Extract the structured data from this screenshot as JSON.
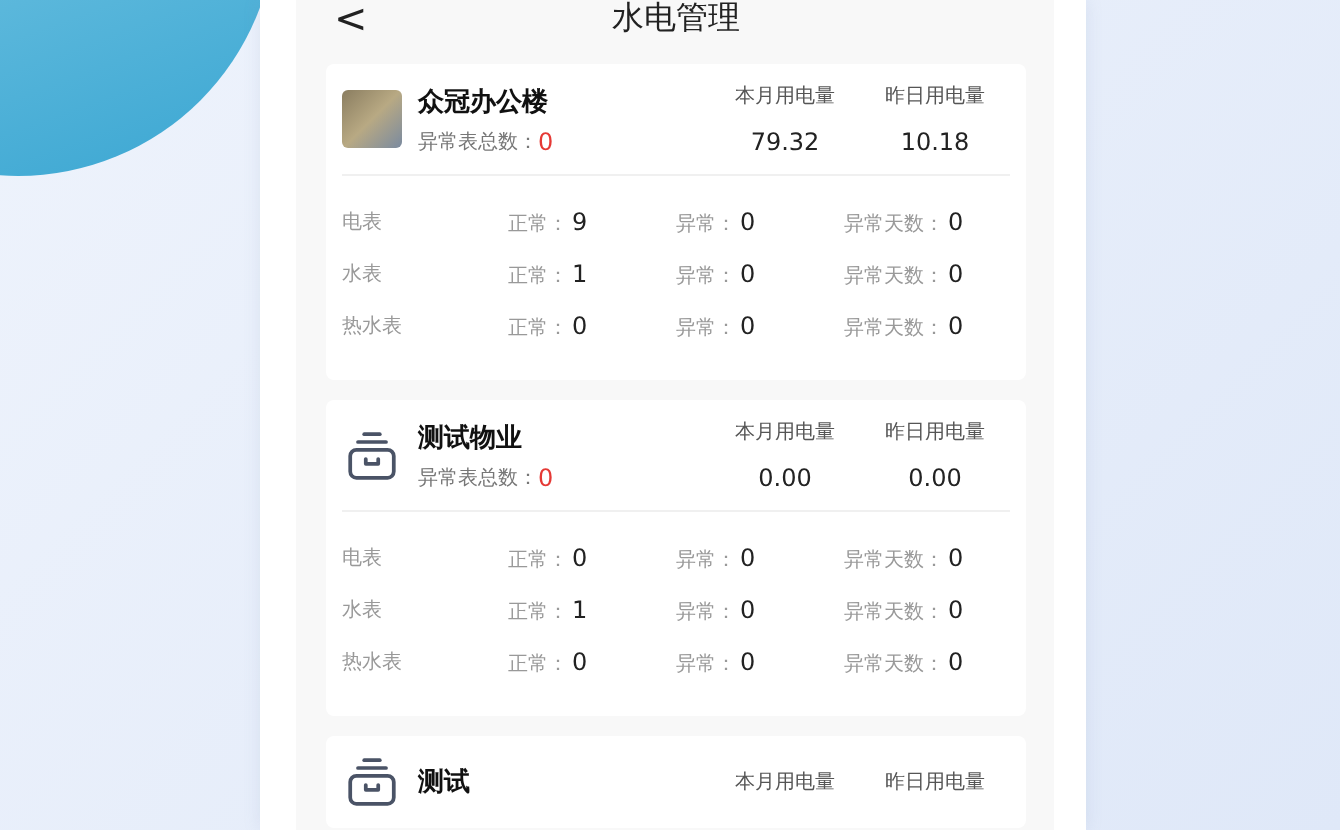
{
  "header": {
    "back": "<",
    "title": "水电管理"
  },
  "cards": [
    {
      "kind": "photo",
      "name": "众冠办公楼",
      "abnormal_label": "异常表总数：",
      "abnormal_total": "0",
      "metrics": [
        {
          "label": "本月用电量",
          "value": "79.32"
        },
        {
          "label": "昨日用电量",
          "value": "10.18"
        }
      ],
      "rows": [
        {
          "name": "电表",
          "stats": [
            {
              "label": "正常：",
              "value": "9"
            },
            {
              "label": "异常：",
              "value": "0"
            },
            {
              "label": "异常天数：",
              "value": "0"
            }
          ]
        },
        {
          "name": "水表",
          "stats": [
            {
              "label": "正常：",
              "value": "1"
            },
            {
              "label": "异常：",
              "value": "0"
            },
            {
              "label": "异常天数：",
              "value": "0"
            }
          ]
        },
        {
          "name": "热水表",
          "stats": [
            {
              "label": "正常：",
              "value": "0"
            },
            {
              "label": "异常：",
              "value": "0"
            },
            {
              "label": "异常天数：",
              "value": "0"
            }
          ]
        }
      ]
    },
    {
      "kind": "icon",
      "name": "测试物业",
      "abnormal_label": "异常表总数：",
      "abnormal_total": "0",
      "metrics": [
        {
          "label": "本月用电量",
          "value": "0.00"
        },
        {
          "label": "昨日用电量",
          "value": "0.00"
        }
      ],
      "rows": [
        {
          "name": "电表",
          "stats": [
            {
              "label": "正常：",
              "value": "0"
            },
            {
              "label": "异常：",
              "value": "0"
            },
            {
              "label": "异常天数：",
              "value": "0"
            }
          ]
        },
        {
          "name": "水表",
          "stats": [
            {
              "label": "正常：",
              "value": "1"
            },
            {
              "label": "异常：",
              "value": "0"
            },
            {
              "label": "异常天数：",
              "value": "0"
            }
          ]
        },
        {
          "name": "热水表",
          "stats": [
            {
              "label": "正常：",
              "value": "0"
            },
            {
              "label": "异常：",
              "value": "0"
            },
            {
              "label": "异常天数：",
              "value": "0"
            }
          ]
        }
      ]
    },
    {
      "kind": "icon",
      "name": "测试",
      "metrics": [
        {
          "label": "本月用电量"
        },
        {
          "label": "昨日用电量"
        }
      ]
    }
  ]
}
